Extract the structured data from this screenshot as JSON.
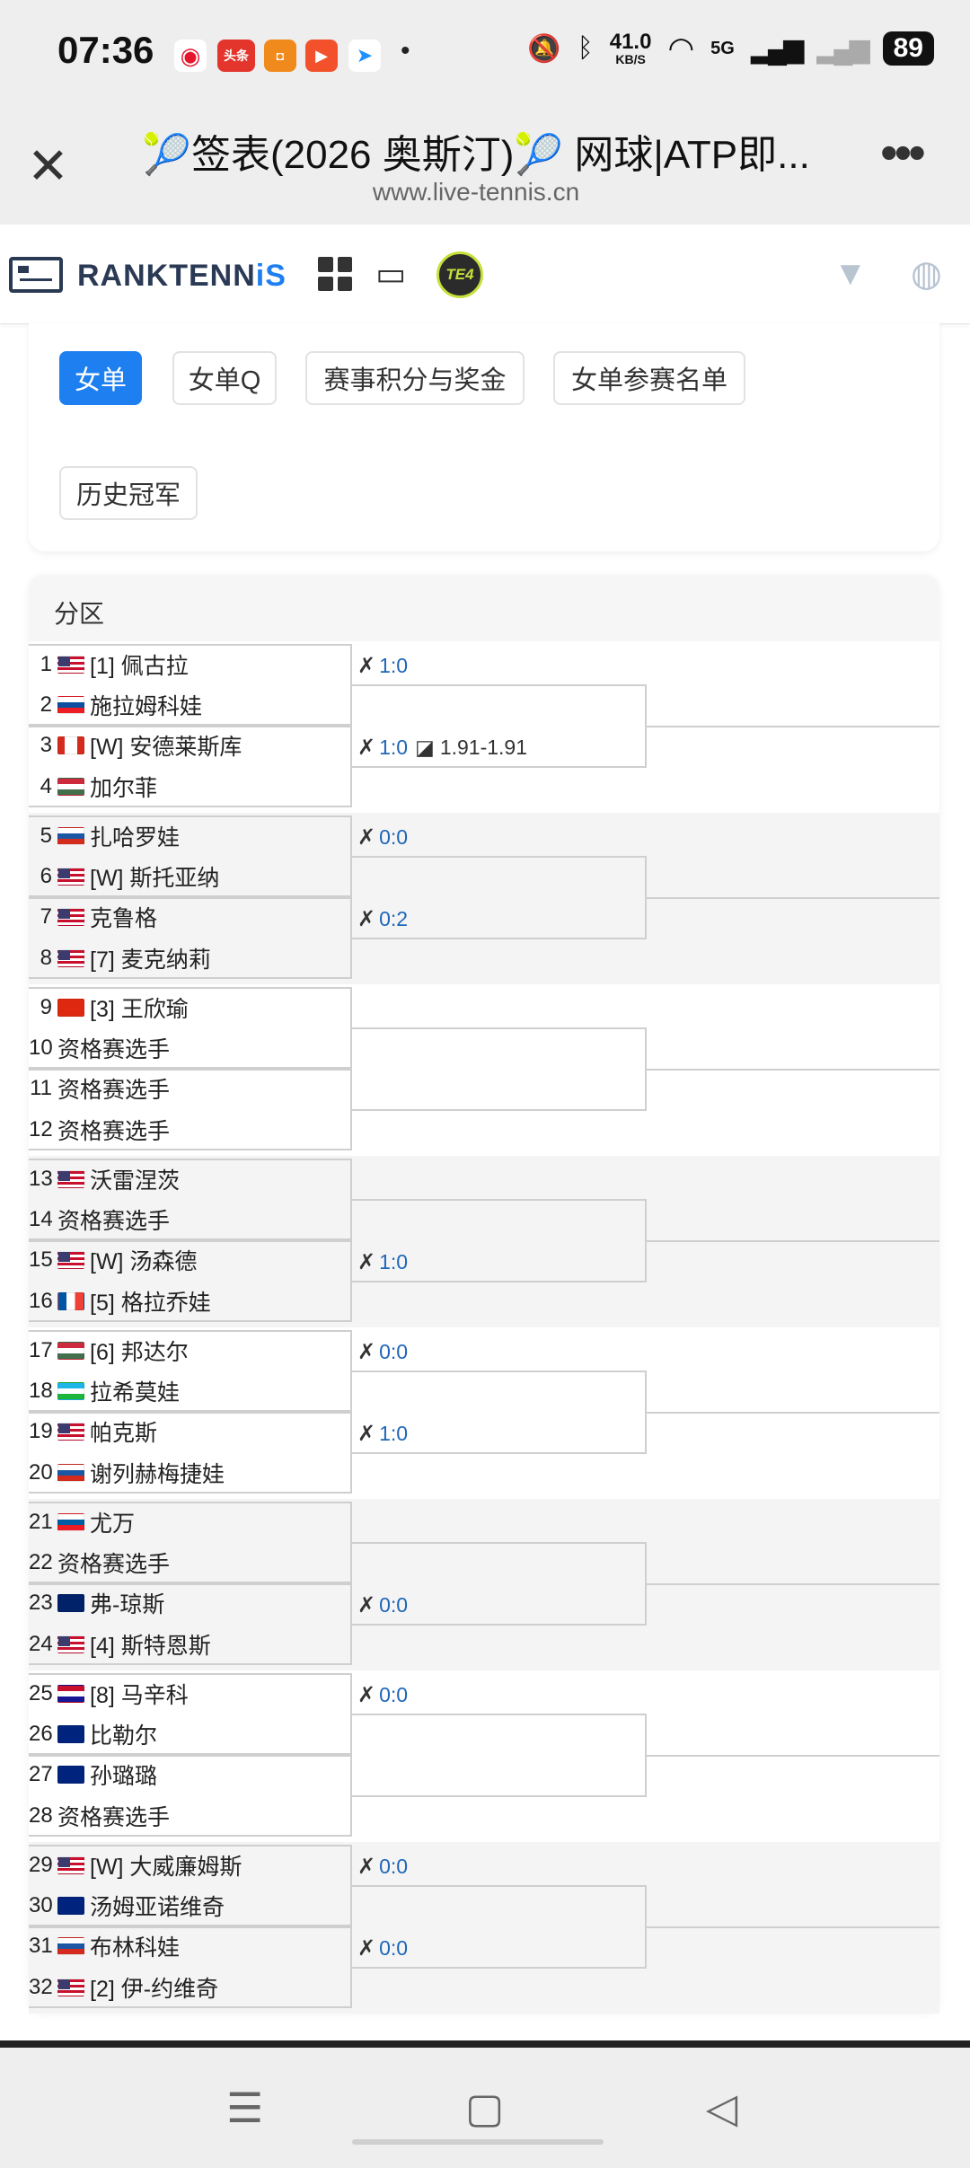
{
  "status_bar": {
    "time": "07:36",
    "app_icons": [
      "weibo-icon",
      "toutiao-icon",
      "app-icon-orange",
      "video-app-icon",
      "tv-app-icon"
    ],
    "toutiao_label": "头条",
    "dot": "•",
    "net_speed": "41.0",
    "net_unit": "KB/S",
    "signal_label": "5G",
    "battery": "89"
  },
  "titlebar": {
    "title": "🎾签表(2026 奥斯汀)🎾 网球|ATP即...",
    "url": "www.live-tennis.cn",
    "close_glyph": "✕",
    "more_glyph": "•••"
  },
  "site_header": {
    "logo_text_a": "RANKTENN",
    "logo_text_b": "i",
    "logo_text_c": "S",
    "badge": "TE4",
    "colors": {
      "logo_dark": "#2a3a55",
      "logo_blue": "#1e7ff0"
    }
  },
  "tabs": [
    {
      "label": "女单",
      "active": true
    },
    {
      "label": "女单Q",
      "active": false
    },
    {
      "label": "赛事积分与奖金",
      "active": false
    },
    {
      "label": "女单参赛名单",
      "active": false
    },
    {
      "label": "历史冠军",
      "active": false
    }
  ],
  "bracket": {
    "section_title": "分区",
    "players": [
      {
        "no": "1",
        "flag": "us",
        "name": "[1] 佩古拉"
      },
      {
        "no": "2",
        "flag": "sk",
        "name": "施拉姆科娃"
      },
      {
        "no": "3",
        "flag": "ca",
        "name": "[W] 安德莱斯库"
      },
      {
        "no": "4",
        "flag": "hu",
        "name": "加尔菲"
      },
      {
        "no": "5",
        "flag": "ru",
        "name": "扎哈罗娃"
      },
      {
        "no": "6",
        "flag": "us",
        "name": "[W] 斯托亚纳"
      },
      {
        "no": "7",
        "flag": "us",
        "name": "克鲁格"
      },
      {
        "no": "8",
        "flag": "us",
        "name": "[7] 麦克纳莉"
      },
      {
        "no": "9",
        "flag": "cn",
        "name": "[3] 王欣瑜"
      },
      {
        "no": "10",
        "flag": "",
        "name": "资格赛选手"
      },
      {
        "no": "11",
        "flag": "",
        "name": "资格赛选手"
      },
      {
        "no": "12",
        "flag": "",
        "name": "资格赛选手"
      },
      {
        "no": "13",
        "flag": "us",
        "name": "沃雷涅茨"
      },
      {
        "no": "14",
        "flag": "",
        "name": "资格赛选手"
      },
      {
        "no": "15",
        "flag": "us",
        "name": "[W] 汤森德"
      },
      {
        "no": "16",
        "flag": "fr",
        "name": "[5] 格拉乔娃"
      },
      {
        "no": "17",
        "flag": "hu",
        "name": "[6] 邦达尔"
      },
      {
        "no": "18",
        "flag": "uz",
        "name": "拉希莫娃"
      },
      {
        "no": "19",
        "flag": "us",
        "name": "帕克斯"
      },
      {
        "no": "20",
        "flag": "ru",
        "name": "谢列赫梅捷娃"
      },
      {
        "no": "21",
        "flag": "si",
        "name": "尤万"
      },
      {
        "no": "22",
        "flag": "",
        "name": "资格赛选手"
      },
      {
        "no": "23",
        "flag": "gb",
        "name": "弗-琼斯"
      },
      {
        "no": "24",
        "flag": "us",
        "name": "[4] 斯特恩斯"
      },
      {
        "no": "25",
        "flag": "hr",
        "name": "[8] 马辛科"
      },
      {
        "no": "26",
        "flag": "au",
        "name": "比勒尔"
      },
      {
        "no": "27",
        "flag": "nz",
        "name": "孙璐璐"
      },
      {
        "no": "28",
        "flag": "",
        "name": "资格赛选手"
      },
      {
        "no": "29",
        "flag": "us",
        "name": "[W] 大威廉姆斯"
      },
      {
        "no": "30",
        "flag": "au",
        "name": "汤姆亚诺维奇"
      },
      {
        "no": "31",
        "flag": "ru",
        "name": "布林科娃"
      },
      {
        "no": "32",
        "flag": "us",
        "name": "[2] 伊-约维奇"
      }
    ],
    "r1_scores": [
      {
        "match": 1,
        "score": "1:0",
        "odds": ""
      },
      {
        "match": 2,
        "score": "1:0",
        "odds": "1.91-1.91"
      },
      {
        "match": 3,
        "score": "0:0",
        "odds": ""
      },
      {
        "match": 4,
        "score": "0:2",
        "odds": ""
      },
      {
        "match": 8,
        "score": "1:0",
        "odds": ""
      },
      {
        "match": 9,
        "score": "0:0",
        "odds": ""
      },
      {
        "match": 10,
        "score": "1:0",
        "odds": ""
      },
      {
        "match": 12,
        "score": "0:0",
        "odds": ""
      },
      {
        "match": 13,
        "score": "0:0",
        "odds": ""
      },
      {
        "match": 15,
        "score": "0:0",
        "odds": ""
      },
      {
        "match": 16,
        "score": "0:0",
        "odds": ""
      }
    ],
    "score_icon": "h2h-icon",
    "odds_icon": "chart-icon"
  },
  "flag_colors": {
    "us": "#3c5aa6",
    "sk": "#0b4ea2",
    "ca": "#d52b1e",
    "hu": "#436f4d",
    "ru": "#1c57a5",
    "cn": "#de2910",
    "fr": "#0055a4",
    "uz": "#1eb53a",
    "si": "#005da4",
    "gb": "#012169",
    "hr": "#c8102e",
    "au": "#00247d",
    "nz": "#00247d"
  },
  "navbar": {
    "menu_glyph": "☰",
    "home_glyph": "▢",
    "back_glyph": "◁"
  }
}
